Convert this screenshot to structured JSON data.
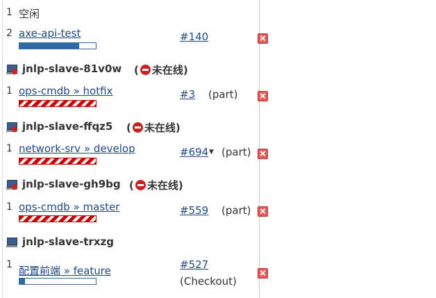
{
  "colors": {
    "link": "#204a87",
    "progress": "#2e69a3",
    "failed_stripe": "#d10000",
    "offline_icon": "#cc1f1f"
  },
  "rows": {
    "idle": {
      "num": "1",
      "label": "空闲"
    },
    "axe": {
      "num": "2",
      "job": "axe-api-test",
      "build": "#140",
      "progress": 0.78
    },
    "node1": {
      "name": "jnlp-slave-81v0w",
      "paren_open": "(",
      "status": "未在线",
      "paren_close": ")"
    },
    "hotfix": {
      "num": "1",
      "job": "ops-cmdb » hotfix",
      "build": "#3",
      "part": "(part)"
    },
    "node2": {
      "name": "jnlp-slave-ffqz5",
      "paren_open": "(",
      "status": "未在线",
      "paren_close": ")"
    },
    "develop": {
      "num": "1",
      "job": "network-srv » develop",
      "build": "#694",
      "caret": "▼",
      "part": "(part)"
    },
    "node3": {
      "name": "jnlp-slave-gh9bg",
      "paren_open": "(",
      "status": "未在线",
      "paren_close": ")"
    },
    "master": {
      "num": "1",
      "job": "ops-cmdb » master",
      "build": "#559",
      "part": "(part)"
    },
    "node4": {
      "name": "jnlp-slave-trxzg"
    },
    "feature": {
      "num": "1",
      "job": "配置前端 » feature",
      "build": "#527",
      "checkout": "(Checkout)",
      "progress": 0.07
    }
  }
}
